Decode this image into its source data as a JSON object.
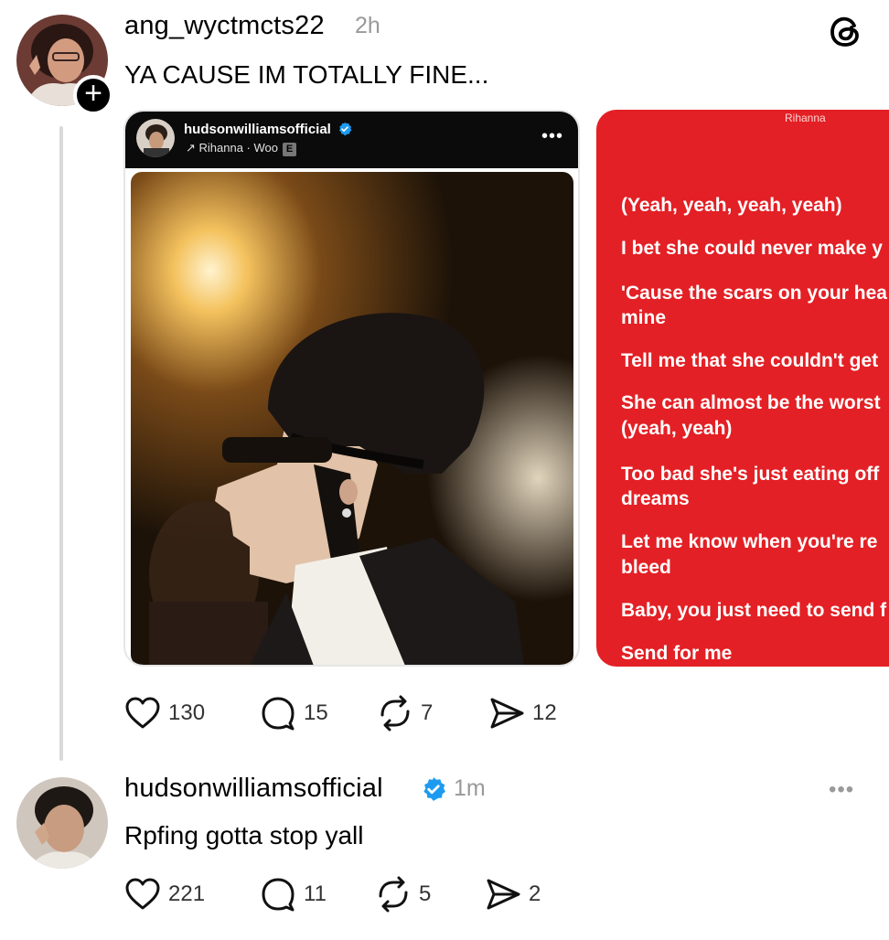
{
  "post1": {
    "username": "ang_wyctmcts22",
    "time": "2h",
    "text": "YA CAUSE IM TOTALLY FINE...",
    "follow_symbol": "+",
    "embed": {
      "username": "hudsonwilliamsofficial",
      "music": "↗ Rihanna · Woo",
      "explicit": "E",
      "more": "•••"
    },
    "lyrics_card": {
      "artist": "Rihanna",
      "lines": [
        "(Yeah, yeah, yeah, yeah)",
        "I bet she could never make y",
        "'Cause the scars on your hea",
        "mine",
        "Tell me that she couldn't get",
        "She can almost be the worst",
        "(yeah, yeah)",
        "Too bad she's just eating off",
        "dreams",
        "Let me know when you're re",
        "bleed",
        "Baby, you just need to send f",
        "Send for me"
      ]
    },
    "stats": {
      "likes": "130",
      "replies": "15",
      "reposts": "7",
      "shares": "12"
    }
  },
  "post2": {
    "username": "hudsonwilliamsofficial",
    "time": "1m",
    "text": "Rpfing gotta stop yall",
    "more": "•••",
    "stats": {
      "likes": "221",
      "replies": "11",
      "reposts": "5",
      "shares": "2"
    }
  },
  "colors": {
    "verified": "#1d9bf0",
    "lyrics_bg": "#e32025",
    "thread_line": "#d9d9d9"
  }
}
